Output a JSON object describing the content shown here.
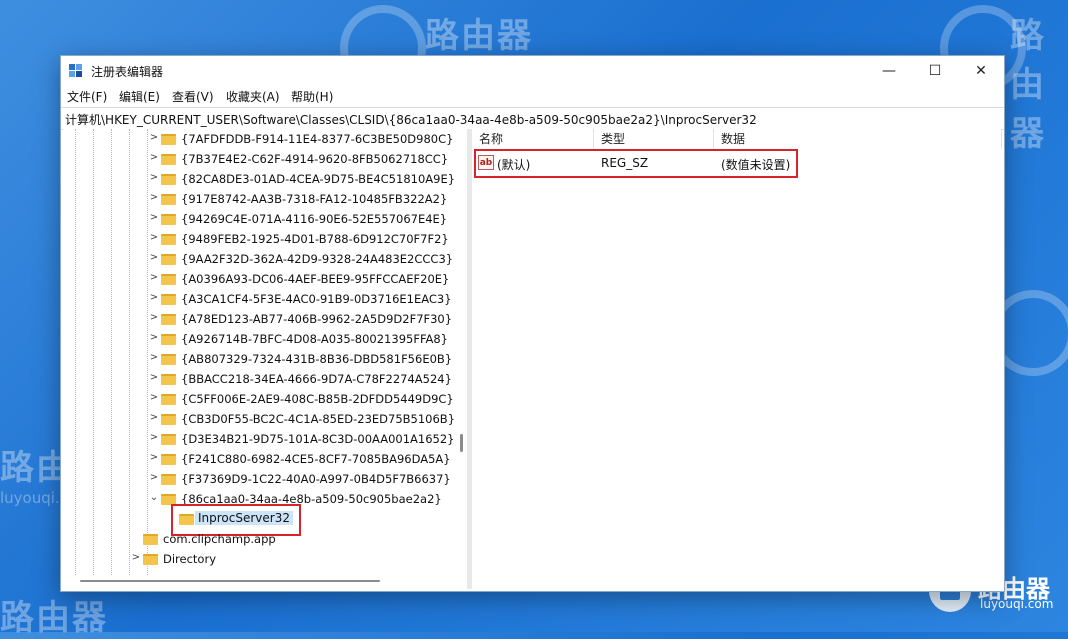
{
  "watermark": {
    "brand": "路由器",
    "domain": "luyouqi.com"
  },
  "window": {
    "title": "注册表编辑器",
    "controls": {
      "minimize": "—",
      "maximize": "☐",
      "close": "✕"
    }
  },
  "menu": [
    "文件(F)",
    "编辑(E)",
    "查看(V)",
    "收藏夹(A)",
    "帮助(H)"
  ],
  "address": "计算机\\HKEY_CURRENT_USER\\Software\\Classes\\CLSID\\{86ca1aa0-34aa-4e8b-a509-50c905bae2a2}\\InprocServer32",
  "tree": {
    "keys": [
      "{7AFDFDDB-F914-11E4-8377-6C3BE50D980C}",
      "{7B37E4E2-C62F-4914-9620-8FB5062718CC}",
      "{82CA8DE3-01AD-4CEA-9D75-BE4C51810A9E}",
      "{917E8742-AA3B-7318-FA12-10485FB322A2}",
      "{94269C4E-071A-4116-90E6-52E557067E4E}",
      "{9489FEB2-1925-4D01-B788-6D912C70F7F2}",
      "{9AA2F32D-362A-42D9-9328-24A483E2CCC3}",
      "{A0396A93-DC06-4AEF-BEE9-95FFCCAEF20E}",
      "{A3CA1CF4-5F3E-4AC0-91B9-0D3716E1EAC3}",
      "{A78ED123-AB77-406B-9962-2A5D9D2F7F30}",
      "{A926714B-7BFC-4D08-A035-80021395FFA8}",
      "{AB807329-7324-431B-8B36-DBD581F56E0B}",
      "{BBACC218-34EA-4666-9D7A-C78F2274A524}",
      "{C5FF006E-2AE9-408C-B85B-2DFDD5449D9C}",
      "{CB3D0F55-BC2C-4C1A-85ED-23ED75B5106B}",
      "{D3E34B21-9D75-101A-8C3D-00AA001A1652}",
      "{F241C880-6982-4CE5-8CF7-7085BA96DA5A}",
      "{F37369D9-1C22-40A0-A997-0B4D5F7B6637}"
    ],
    "expanded_key": "{86ca1aa0-34aa-4e8b-a509-50c905bae2a2}",
    "selected_key": "InprocServer32",
    "after_keys": [
      "com.clipchamp.app",
      "Directory"
    ],
    "chevron_collapsed": ">",
    "chevron_expanded": "⌄"
  },
  "list": {
    "columns": [
      "名称",
      "类型",
      "数据"
    ],
    "rows": [
      {
        "name": "(默认)",
        "type": "REG_SZ",
        "data": "(数值未设置)",
        "icon": "ab"
      }
    ]
  },
  "colors": {
    "highlight": "#d8232a",
    "folder": "#f3c54b",
    "background": "#1a6fd0"
  }
}
